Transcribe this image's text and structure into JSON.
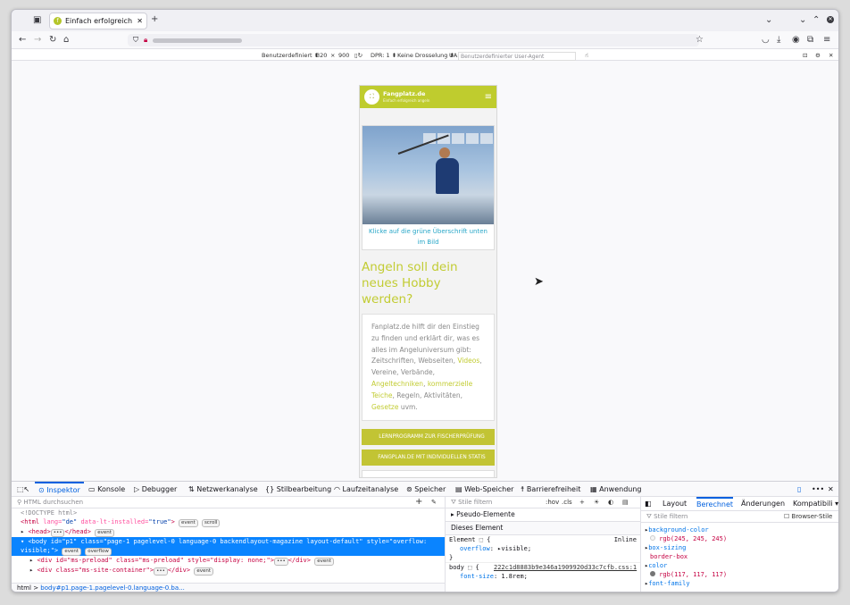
{
  "browser": {
    "tab_title": "Einfach erfolgreich ange",
    "tab_favicon": "f"
  },
  "rdm": {
    "device": "Benutzerdefiniert ⬍",
    "width": "320",
    "times": "×",
    "height": "900",
    "dpr": "DPR: 1 ⬍",
    "throttle": "Keine Drosselung ⬍",
    "ua_label": "UA:",
    "ua_placeholder": "Benutzerdefinierter User-Agent"
  },
  "site": {
    "brand": "Fangplatz.de",
    "tagline": "Einfach erfolgreich angeln",
    "caption": "Klicke auf die grüne Überschrift unten im Bild",
    "heading": "Angeln soll dein neues Hobby werden?",
    "text_1": "Fanplatz.de hilft dir den Einstieg zu finden und erklärt dir, was es alles im Angeluniversum gibt: Zeitschriften, Webseiten, ",
    "link_videos": "Videos",
    "text_2": ", Vereine, Verbände, ",
    "link_techniken": "Angeltechniken",
    "text_3": ", ",
    "link_teiche": "kommerzielle Teiche",
    "text_4": ", Regeln, Aktivitäten, ",
    "link_gesetze": "Gesetze",
    "text_5": " uvm.",
    "btn_1": "LERNPROGRAMM ZUR FISCHERPRÜFUNG",
    "btn_2": "FANGPLAN.DE MIT INDIVIDUELLEN STATIS"
  },
  "devtools": {
    "tabs": [
      "Inspektor",
      "Konsole",
      "Debugger",
      "Netzwerkanalyse",
      "Stilbearbeitung",
      "Laufzeitanalyse",
      "Speicher",
      "Web-Speicher",
      "Barrierefreiheit",
      "Anwendung"
    ],
    "html_search": "HTML durchsuchen",
    "lines": {
      "doctype": "<!DOCTYPE html>",
      "html_open": "<html",
      "html_attr": " lang=",
      "html_lang": "\"de\"",
      "html_attr2": " data-lt-installed=",
      "html_val2": "\"true\"",
      "head": "<head>",
      "head_close": "</head>",
      "body": "<body id=\"p1\" class=\"page-1 pagelevel-0 language-0 backendlayout-magazine layout-default\" style=\"overflow: visible;\">",
      "div1": "<div id=\"ms-preload\" class=\"ms-preload\" style=\"display: none;\">",
      "div1_close": "</div>",
      "div2": "<div class=\"ms-site-container\">",
      "div2_close": "</div>"
    },
    "badges": {
      "event": "event",
      "scroll": "scroll",
      "overflow": "overflow",
      "dots": "•••"
    },
    "breadcrumb_1": "html",
    "breadcrumb_sep": ">",
    "breadcrumb_2": "body#p1.page-1.pagelevel-0.language-0.ba...",
    "styles": {
      "filter": "Stile filtern",
      "hov": ":hov",
      "cls": ".cls",
      "pseudo": "Pseudo-Elemente",
      "this_element": "Dieses Element",
      "element_rule": "Element",
      "brace_open": "{",
      "brace_close": "}",
      "inline": "Inline",
      "overflow_prop": "overflow",
      "overflow_val": "visible;",
      "body_sel": "body",
      "body_src": "222c1d8883b9e346a1909920d33c7cfb.css:1",
      "fontsize_prop": "font-size",
      "fontsize_val": "1.8rem;"
    },
    "computed": {
      "tabs": [
        "Layout",
        "Berechnet",
        "Änderungen",
        "Kompatibili ▾"
      ],
      "filter": "Stile filtern",
      "browser_styles": "Browser-Stile",
      "p1": "background-color",
      "v1": "rgb(245, 245, 245)",
      "p2": "box-sizing",
      "v2": "border-box",
      "p3": "color",
      "v3": "rgb(117, 117, 117)",
      "p4": "font-family"
    }
  }
}
